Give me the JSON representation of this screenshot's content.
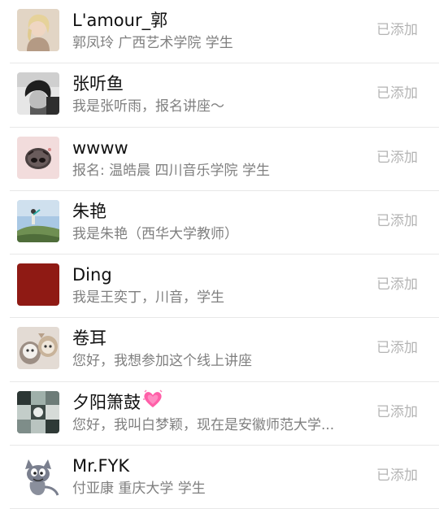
{
  "contacts": [
    {
      "name": "L'amour_郭",
      "message": "郭凤玲  广西艺术学院  学生",
      "status": "已添加",
      "avatar_icon": "girl-portrait-avatar",
      "avatar_color": "#c9b4a0"
    },
    {
      "name": "张听鱼",
      "message": "我是张听雨，报名讲座～",
      "status": "已添加",
      "avatar_icon": "bw-boy-portrait-avatar",
      "avatar_color": "#3a3a3a"
    },
    {
      "name": "wwww",
      "message": "报名: 温皓晨 四川音乐学院 学生",
      "status": "已添加",
      "avatar_icon": "cartoon-face-avatar",
      "avatar_color": "#f0d6d6"
    },
    {
      "name": "朱艳",
      "message": "我是朱艳（西华大学教师）",
      "status": "已添加",
      "avatar_icon": "figure-on-hill-avatar",
      "avatar_color": "#8fb6d8"
    },
    {
      "name": "Ding",
      "message": "我是王奕丁，川音，学生",
      "status": "已添加",
      "avatar_icon": "solid-red-avatar",
      "avatar_color": "#8f1a14"
    },
    {
      "name": "卷耳",
      "message": "您好，我想参加这个线上讲座",
      "status": "已添加",
      "avatar_icon": "cats-avatar",
      "avatar_color": "#d8cfc8"
    },
    {
      "name": "夕阳箫鼓",
      "message": "您好，我叫白梦颖，现在是安徽师范大学...",
      "status": "已添加",
      "avatar_icon": "collage-avatar",
      "avatar_color": "#7c8a86",
      "badge_icon": "sparkling-heart-icon"
    },
    {
      "name": "Mr.FYK",
      "message": "付亚康 重庆大学 学生",
      "status": "已添加",
      "avatar_icon": "cartoon-cat-avatar",
      "avatar_color": "#ffffff"
    }
  ]
}
